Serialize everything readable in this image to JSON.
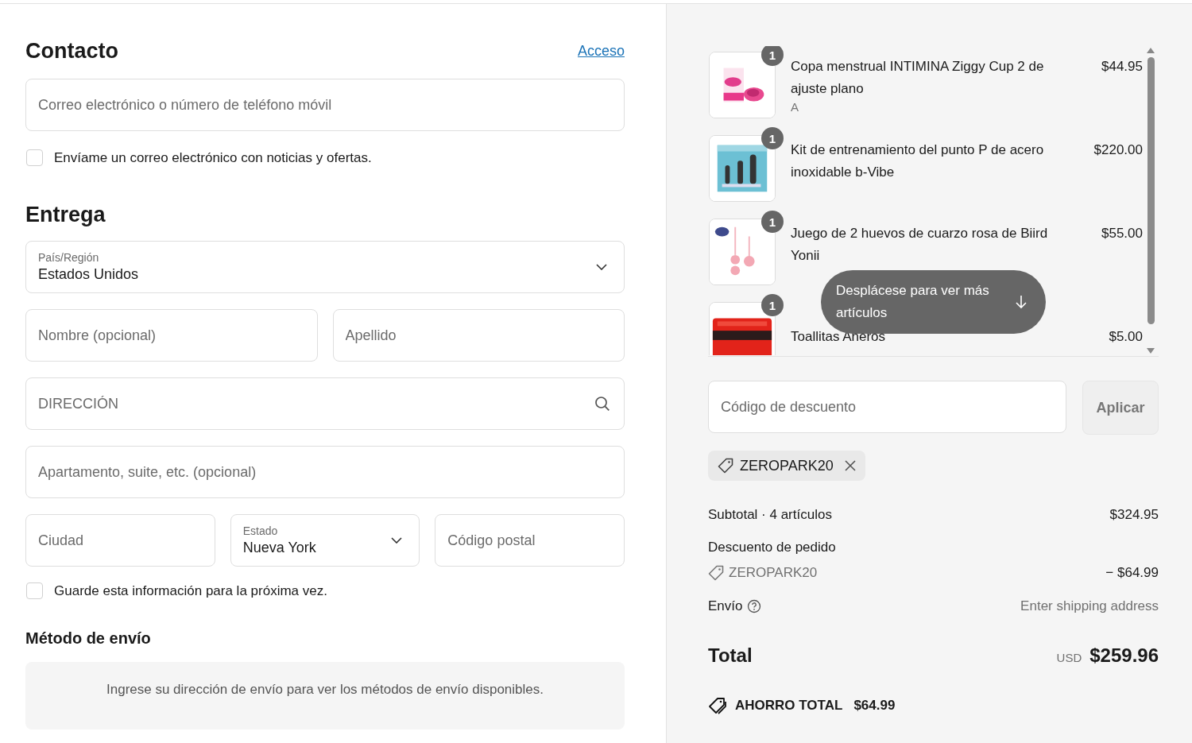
{
  "contact": {
    "heading": "Contacto",
    "login_link": "Acceso",
    "email": {
      "placeholder": "Correo electrónico o número de teléfono móvil"
    },
    "newsletter": {
      "label": "Envíame un correo electrónico con noticias y ofertas.",
      "checked": false
    }
  },
  "delivery": {
    "heading": "Entrega",
    "rows": [
      [
        {
          "kind": "select",
          "label": "País/Región",
          "value": "Estados Unidos"
        }
      ],
      [
        {
          "kind": "input",
          "placeholder": "Nombre (opcional)"
        },
        {
          "kind": "input",
          "placeholder": "Apellido"
        }
      ],
      [
        {
          "kind": "search",
          "placeholder": "DIRECCIÓN"
        }
      ],
      [
        {
          "kind": "input",
          "placeholder": "Apartamento, suite, etc. (opcional)"
        }
      ],
      [
        {
          "kind": "input",
          "placeholder": "Ciudad"
        },
        {
          "kind": "select",
          "label": "Estado",
          "value": "Nueva York"
        },
        {
          "kind": "input",
          "placeholder": "Código postal"
        }
      ]
    ],
    "save_info": {
      "label": "Guarde esta información para la próxima vez.",
      "checked": false
    }
  },
  "shipping_method": {
    "heading": "Método de envío",
    "message": "Ingrese su dirección de envío para ver los métodos de envío disponibles."
  },
  "order": {
    "items": [
      {
        "name": "Copa menstrual INTIMINA Ziggy Cup 2 de ajuste plano",
        "variant": "A",
        "price": "$44.95",
        "quantity": "1"
      },
      {
        "name": "Kit de entrenamiento del punto P de acero inoxidable b-Vibe",
        "price": "$220.00",
        "quantity": "1"
      },
      {
        "name": "Juego de 2 huevos de cuarzo rosa de Biird Yonii",
        "price": "$55.00",
        "quantity": "1"
      },
      {
        "name": "Toallitas Aneros",
        "price": "$5.00",
        "quantity": "1"
      }
    ],
    "scroll_hint": "Desplácese para ver más artículos",
    "discount": {
      "placeholder": "Código de descuento",
      "button": "Aplicar"
    },
    "applied_codes": [
      "ZEROPARK20"
    ],
    "summary": {
      "subtotal_label": "Subtotal · 4 artículos",
      "subtotal": "$324.95",
      "discount_label": "Descuento de pedido",
      "discount_code": "ZEROPARK20",
      "discount_amount": "− $64.99",
      "shipping_label": "Envío",
      "shipping_value": "Enter shipping address",
      "total_label": "Total",
      "currency": "USD",
      "total": "$259.96",
      "savings_label": "AHORRO TOTAL",
      "savings": "$64.99"
    }
  }
}
